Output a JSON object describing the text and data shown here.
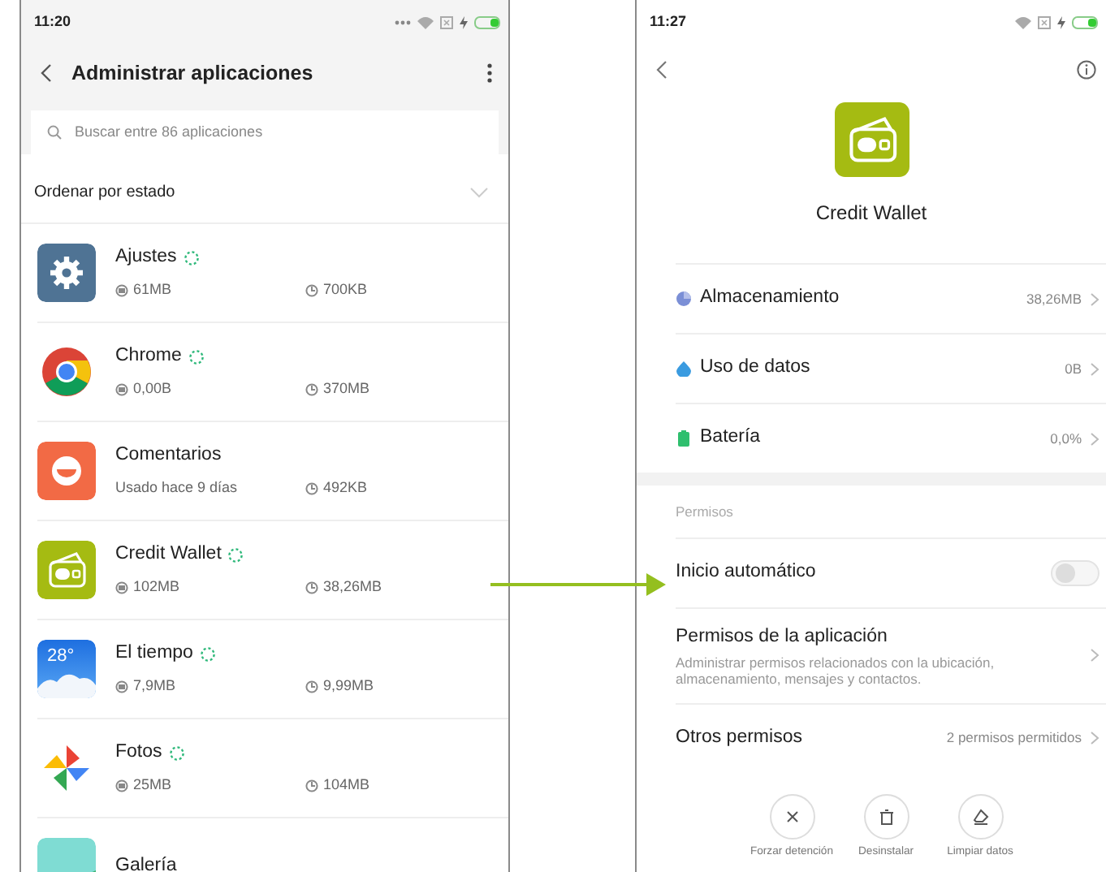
{
  "left_phone": {
    "status_bar": {
      "time": "11:20"
    },
    "header": {
      "title": "Administrar aplicaciones"
    },
    "search": {
      "placeholder": "Buscar entre 86 aplicaciones"
    },
    "sort": {
      "label": "Ordenar por estado"
    },
    "apps": [
      {
        "kind": "settings",
        "name": "Ajustes",
        "running": true,
        "storage": "61MB",
        "cache": "700KB"
      },
      {
        "kind": "browser",
        "name": "Chrome",
        "running": true,
        "storage": "0,00B",
        "cache": "370MB"
      },
      {
        "kind": "feedback",
        "name": "Comentarios",
        "running": false,
        "last_used": "Usado hace 9 días",
        "cache": "492KB"
      },
      {
        "kind": "wallet",
        "name": "Credit Wallet",
        "running": true,
        "storage": "102MB",
        "cache": "38,26MB"
      },
      {
        "kind": "weather",
        "name": "El tiempo",
        "running": true,
        "storage": "7,9MB",
        "cache": "9,99MB",
        "icon_text": "28°"
      },
      {
        "kind": "photos",
        "name": "Fotos",
        "running": true,
        "storage": "25MB",
        "cache": "104MB"
      },
      {
        "kind": "gallery",
        "name": "Galería",
        "running": false
      }
    ]
  },
  "right_phone": {
    "status_bar": {
      "time": "11:27"
    },
    "app_name": "Credit Wallet",
    "details": [
      {
        "kind": "storage",
        "label": "Almacenamiento",
        "value": "38,26MB"
      },
      {
        "kind": "data",
        "label": "Uso de datos",
        "value": "0B"
      },
      {
        "kind": "battery",
        "label": "Batería",
        "value": "0,0%"
      }
    ],
    "section_title": "Permisos",
    "permissions": [
      {
        "kind": "toggle",
        "label": "Inicio automático",
        "on": false
      },
      {
        "kind": "link",
        "label": "Permisos de la aplicación",
        "description": "Administrar permisos relacionados con la ubicación, almacenamiento, mensajes y contactos."
      },
      {
        "kind": "link",
        "label": "Otros permisos",
        "value": "2 permisos permitidos"
      }
    ],
    "actions": [
      {
        "kind": "stop",
        "label": "Forzar detención"
      },
      {
        "kind": "uninstall",
        "label": "Desinstalar"
      },
      {
        "kind": "clear",
        "label": "Limpiar datos"
      }
    ]
  }
}
